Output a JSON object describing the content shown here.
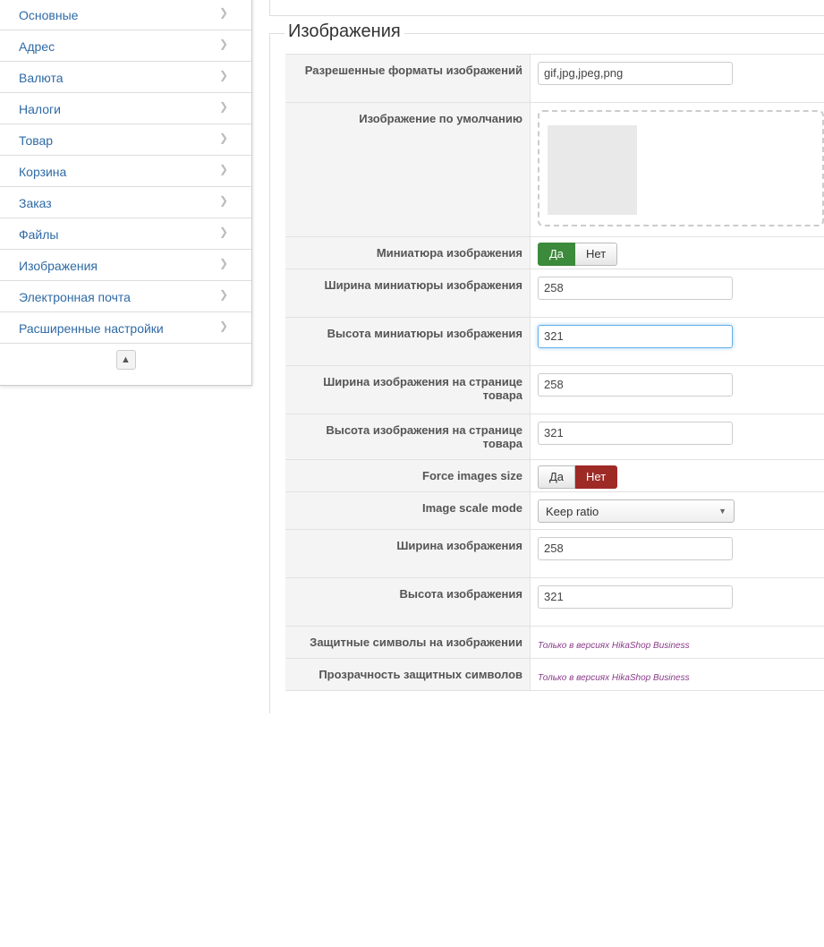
{
  "sidebar": {
    "items": [
      {
        "label": "Основные"
      },
      {
        "label": "Адрес"
      },
      {
        "label": "Валюта"
      },
      {
        "label": "Налоги"
      },
      {
        "label": "Товар"
      },
      {
        "label": "Корзина"
      },
      {
        "label": "Заказ"
      },
      {
        "label": "Файлы"
      },
      {
        "label": "Изображения"
      },
      {
        "label": "Электронная почта"
      },
      {
        "label": "Расширенные настройки"
      }
    ],
    "collapse_glyph": "▲"
  },
  "section": {
    "title": "Изображения",
    "rows": {
      "formats": {
        "label": "Разрешенные форматы изображений",
        "value": "gif,jpg,jpeg,png"
      },
      "default_image": {
        "label": "Изображение по умолчанию"
      },
      "thumbnail": {
        "label": "Миниатюра изображения",
        "yes": "Да",
        "no": "Нет"
      },
      "thumb_width": {
        "label": "Ширина миниатюры изображения",
        "value": "258"
      },
      "thumb_height": {
        "label": "Высота миниатюры изображения",
        "value": "321"
      },
      "product_width": {
        "label": "Ширина изображения на странице товара",
        "value": "258"
      },
      "product_height": {
        "label": "Высота изображения на странице товара",
        "value": "321"
      },
      "force_size": {
        "label": "Force images size",
        "yes": "Да",
        "no": "Нет"
      },
      "scale_mode": {
        "label": "Image scale mode",
        "value": "Keep ratio"
      },
      "image_width": {
        "label": "Ширина изображения",
        "value": "258"
      },
      "image_height": {
        "label": "Высота изображения",
        "value": "321"
      },
      "watermark": {
        "label": "Защитные символы на изображении",
        "note": "Только в версиях HikaShop Business"
      },
      "watermark_opacity": {
        "label": "Прозрачность защитных символов",
        "note": "Только в версиях HikaShop Business"
      }
    }
  },
  "colors": {
    "link": "#2f6aa6",
    "yes_active": "#3c8a3b",
    "no_active": "#9e2a26",
    "business_note": "#8a3c8a"
  }
}
